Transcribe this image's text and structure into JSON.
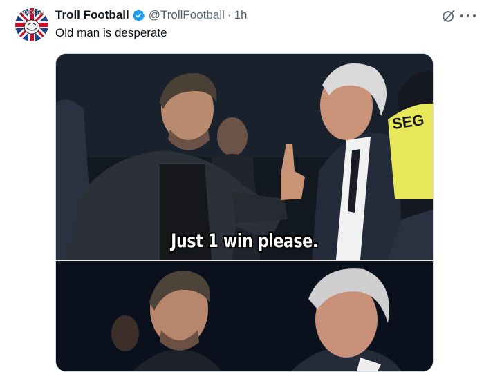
{
  "tweet": {
    "display_name": "Troll Football",
    "handle": "@TrollFootball",
    "separator": "·",
    "time": "1h",
    "text": "Old man is desperate",
    "verified": true
  },
  "avatar": {
    "logo_text": "SOCCER",
    "icon": "union-jack-troll-face-icon"
  },
  "actions": {
    "grok_icon": "grok-icon",
    "more_icon": "more-dots-icon"
  },
  "media": {
    "caption": "Just 1 win please.",
    "background_sign": "SEG"
  },
  "colors": {
    "text_primary": "#0f1419",
    "text_secondary": "#536471",
    "verified_blue": "#1d9bf0",
    "border": "#cfd9de"
  }
}
